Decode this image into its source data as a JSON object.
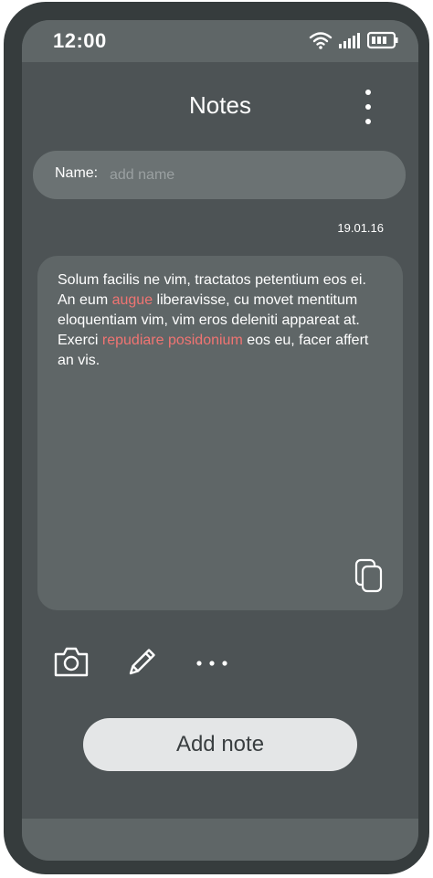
{
  "status": {
    "time": "12:00"
  },
  "header": {
    "title": "Notes"
  },
  "name_field": {
    "label": "Name:",
    "placeholder": "add name"
  },
  "note": {
    "date": "19.01.16",
    "segments": [
      {
        "text": "Solum facilis ne vim, tractatos petentium eos ei. An eum ",
        "highlight": false
      },
      {
        "text": "augue",
        "highlight": true
      },
      {
        "text": " liberavisse, cu movet mentitum eloquentiam vim, vim eros deleniti appareat at. Exerci ",
        "highlight": false
      },
      {
        "text": "repudiare posidonium",
        "highlight": true
      },
      {
        "text": " eos eu, facer affert an vis.",
        "highlight": false
      }
    ],
    "highlight_color": "#f07472"
  },
  "toolbar": {
    "icons": [
      "camera-icon",
      "pencil-icon",
      "more-horizontal-icon"
    ]
  },
  "actions": {
    "add_note_label": "Add note"
  }
}
